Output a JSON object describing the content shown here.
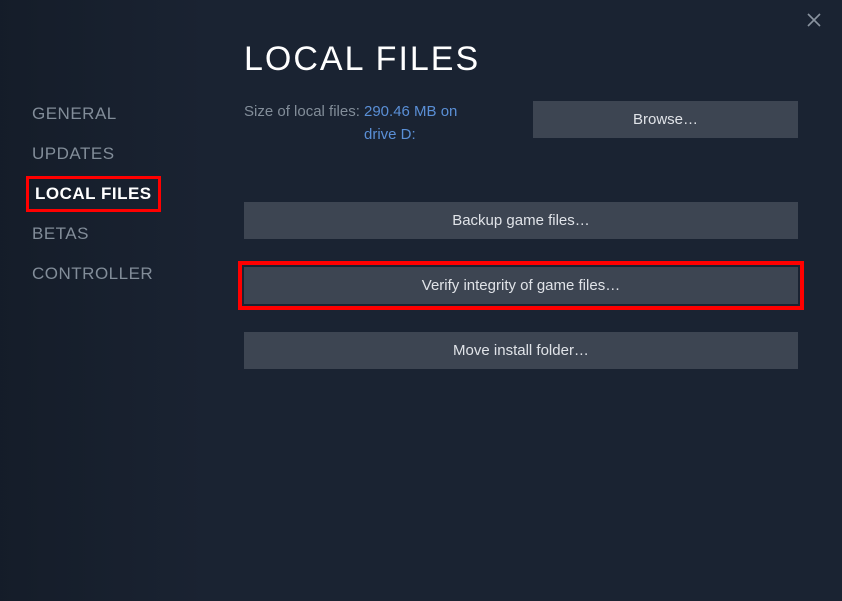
{
  "sidebar": {
    "items": [
      {
        "label": "GENERAL",
        "active": false,
        "highlighted": false
      },
      {
        "label": "UPDATES",
        "active": false,
        "highlighted": false
      },
      {
        "label": "LOCAL FILES",
        "active": true,
        "highlighted": true
      },
      {
        "label": "BETAS",
        "active": false,
        "highlighted": false
      },
      {
        "label": "CONTROLLER",
        "active": false,
        "highlighted": false
      }
    ]
  },
  "main": {
    "title": "LOCAL FILES",
    "size_label": "Size of local files:",
    "size_value_line1": "290.46 MB on",
    "size_value_line2": "drive D:",
    "browse_label": "Browse…",
    "buttons": {
      "backup": "Backup game files…",
      "verify": "Verify integrity of game files…",
      "move": "Move install folder…"
    }
  }
}
